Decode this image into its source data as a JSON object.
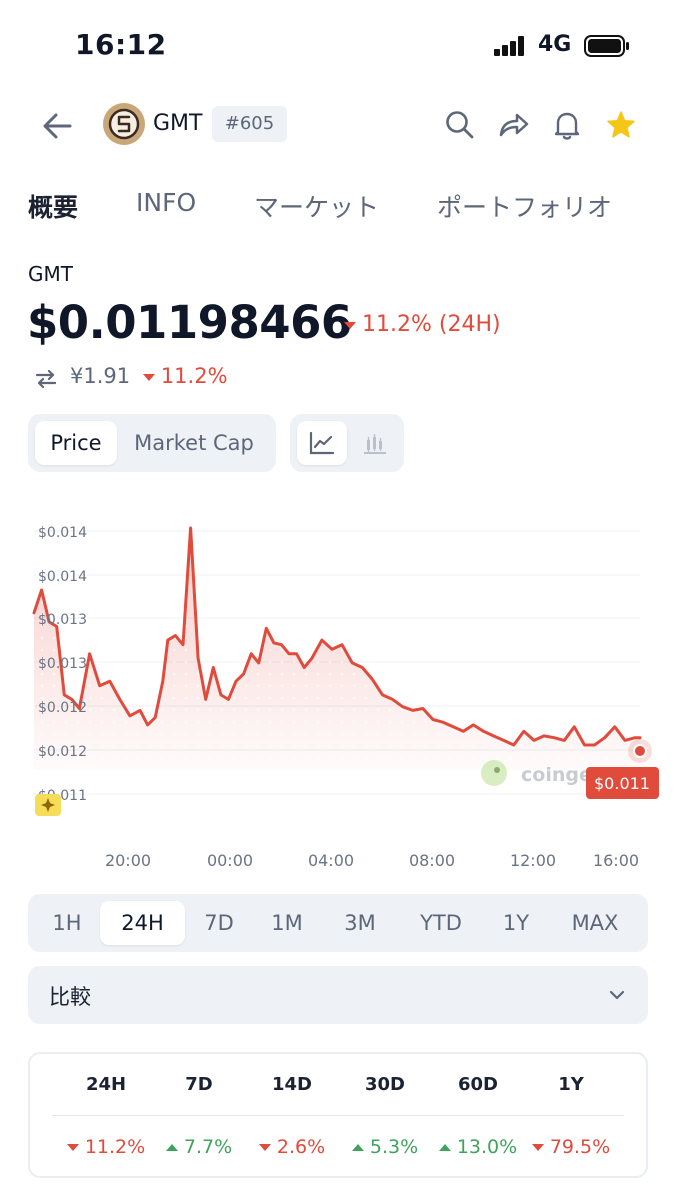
{
  "status": {
    "time": "16:12",
    "network": "4G"
  },
  "nav": {
    "coin": "GMT",
    "rank": "#605"
  },
  "tabs": [
    "概要",
    "INFO",
    "マーケット",
    "ポートフォリオ"
  ],
  "summary": {
    "symbol": "GMT",
    "price": "$0.01198466",
    "change_24h": "11.2% (24H)",
    "converted_price": "¥1.91",
    "converted_change": "11.2%"
  },
  "chart_toggle": {
    "price": "Price",
    "market_cap": "Market Cap"
  },
  "chart_data": {
    "type": "area",
    "y_tick_labels": [
      "$0.014",
      "$0.014",
      "$0.013",
      "$0.013",
      "$0.012",
      "$0.012",
      "$0.011"
    ],
    "x_tick_labels": [
      "20:00",
      "00:00",
      "04:00",
      "08:00",
      "12:00",
      "16:00"
    ],
    "watermark": "coingecko",
    "current_price_label": "$0.011",
    "series": [
      {
        "x_hours_from_first": [
          0,
          0.3,
          0.6,
          0.9,
          1.2,
          1.5,
          1.8,
          2.2,
          2.6,
          3.0,
          3.4,
          3.8,
          4.2,
          4.5,
          4.8,
          5.1,
          5.3,
          5.6,
          5.9,
          6.2,
          6.5,
          6.8,
          7.1,
          7.4,
          7.7,
          8.0,
          8.3,
          8.6,
          8.9,
          9.2,
          9.5,
          9.8,
          10.1,
          10.4,
          10.7,
          11.0,
          11.4,
          11.8,
          12.2,
          12.6,
          13.0,
          13.4,
          13.8,
          14.2,
          14.6,
          15.0,
          15.4,
          15.8,
          16.2,
          16.6,
          17.0,
          17.4,
          17.8,
          18.2,
          18.6,
          19.0,
          19.4,
          19.8,
          20.2,
          20.6,
          21.0,
          21.4,
          21.8,
          22.2,
          22.6,
          23.0,
          23.4,
          23.8,
          24.0
        ],
        "values": [
          0.01335,
          0.0136,
          0.01325,
          0.0132,
          0.01245,
          0.0124,
          0.0123,
          0.0129,
          0.01255,
          0.0126,
          0.0124,
          0.01222,
          0.01228,
          0.01212,
          0.0122,
          0.0126,
          0.01305,
          0.0131,
          0.013,
          0.01428,
          0.01285,
          0.0124,
          0.01275,
          0.01245,
          0.0124,
          0.0126,
          0.01268,
          0.0129,
          0.0128,
          0.01318,
          0.01302,
          0.013,
          0.0129,
          0.0129,
          0.01275,
          0.01285,
          0.01305,
          0.01295,
          0.013,
          0.0128,
          0.01275,
          0.01262,
          0.01245,
          0.0124,
          0.01232,
          0.01228,
          0.0123,
          0.01218,
          0.01215,
          0.0121,
          0.01205,
          0.01212,
          0.01205,
          0.012,
          0.01195,
          0.0119,
          0.01205,
          0.01195,
          0.012,
          0.01198,
          0.01195,
          0.0121,
          0.0119,
          0.0119,
          0.01198,
          0.0121,
          0.01195,
          0.01198,
          0.01198
        ]
      }
    ],
    "color": "#e04b3c",
    "grid": true
  },
  "ranges": [
    "1H",
    "24H",
    "7D",
    "1M",
    "3M",
    "YTD",
    "1Y",
    "MAX"
  ],
  "selected_range": "24H",
  "compare": {
    "label": "比較"
  },
  "performance": {
    "headers": [
      "24H",
      "7D",
      "14D",
      "30D",
      "60D",
      "1Y"
    ],
    "values": [
      "11.2%",
      "7.7%",
      "2.6%",
      "5.3%",
      "13.0%",
      "79.5%"
    ],
    "directions": [
      "down",
      "up",
      "down",
      "up",
      "up",
      "down"
    ]
  },
  "colors": {
    "down": "#e04b3c",
    "up": "#3fa35b",
    "star": "#f5c518",
    "accent_bg": "#eef1f5"
  },
  "icons": [
    "back-arrow-icon",
    "coin-logo-icon",
    "search-icon",
    "share-icon",
    "bell-icon",
    "star-icon",
    "swap-icon",
    "line-chart-icon",
    "candlestick-icon",
    "sparkle-icon",
    "chevron-down-icon"
  ]
}
